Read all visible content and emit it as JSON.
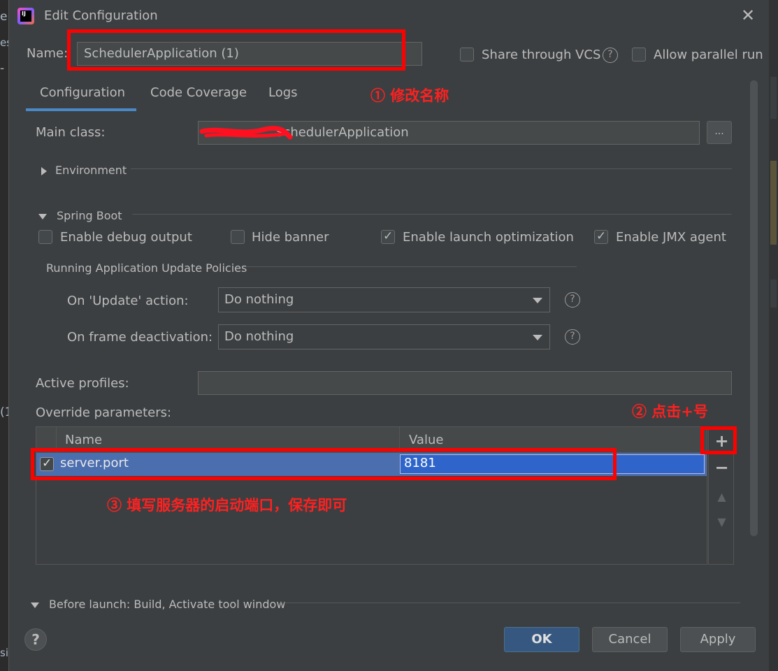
{
  "background": {
    "left_fragments": [
      "er",
      "es",
      "-",
      "(1",
      "si"
    ]
  },
  "dialog": {
    "title": "Edit Configuration",
    "name_label": "Name:",
    "name_value": "SchedulerApplication (1)",
    "share_vcs_label": "Share through VCS",
    "allow_parallel_label": "Allow parallel run",
    "help_glyph": "?"
  },
  "tabs": [
    {
      "label": "Configuration",
      "active": true
    },
    {
      "label": "Code Coverage",
      "active": false
    },
    {
      "label": "Logs",
      "active": false
    }
  ],
  "config": {
    "main_class_label": "Main class:",
    "main_class_value": "SchedulerApplication",
    "browse_label": "...",
    "environment_label": "Environment",
    "spring_boot_label": "Spring Boot",
    "checkboxes": [
      {
        "label": "Enable debug output",
        "checked": false
      },
      {
        "label": "Hide banner",
        "checked": false
      },
      {
        "label": "Enable launch optimization",
        "checked": true
      },
      {
        "label": "Enable JMX agent",
        "checked": true
      }
    ],
    "policies_label": "Running Application Update Policies",
    "update_action_label": "On 'Update' action:",
    "update_action_value": "Do nothing",
    "frame_deactivation_label": "On frame deactivation:",
    "frame_deactivation_value": "Do nothing",
    "active_profiles_label": "Active profiles:",
    "active_profiles_value": "",
    "override_label": "Override parameters:"
  },
  "table": {
    "columns": [
      "Name",
      "Value"
    ],
    "rows": [
      {
        "checked": true,
        "name": "server.port",
        "value": "8181"
      }
    ]
  },
  "toolbar": {
    "add": "+",
    "remove": "−",
    "up": "▲",
    "down": "▼"
  },
  "before_launch_label": "Before launch: Build, Activate tool window",
  "buttons": {
    "ok": "OK",
    "cancel": "Cancel",
    "apply": "Apply"
  },
  "annotations": {
    "note1": "① 修改名称",
    "note2": "② 点击+号",
    "note3": "③ 填写服务器的启动端口，保存即可"
  },
  "colors": {
    "annotation": "#ff0000",
    "selection": "#4b6eaf",
    "primary_button": "#365880"
  }
}
